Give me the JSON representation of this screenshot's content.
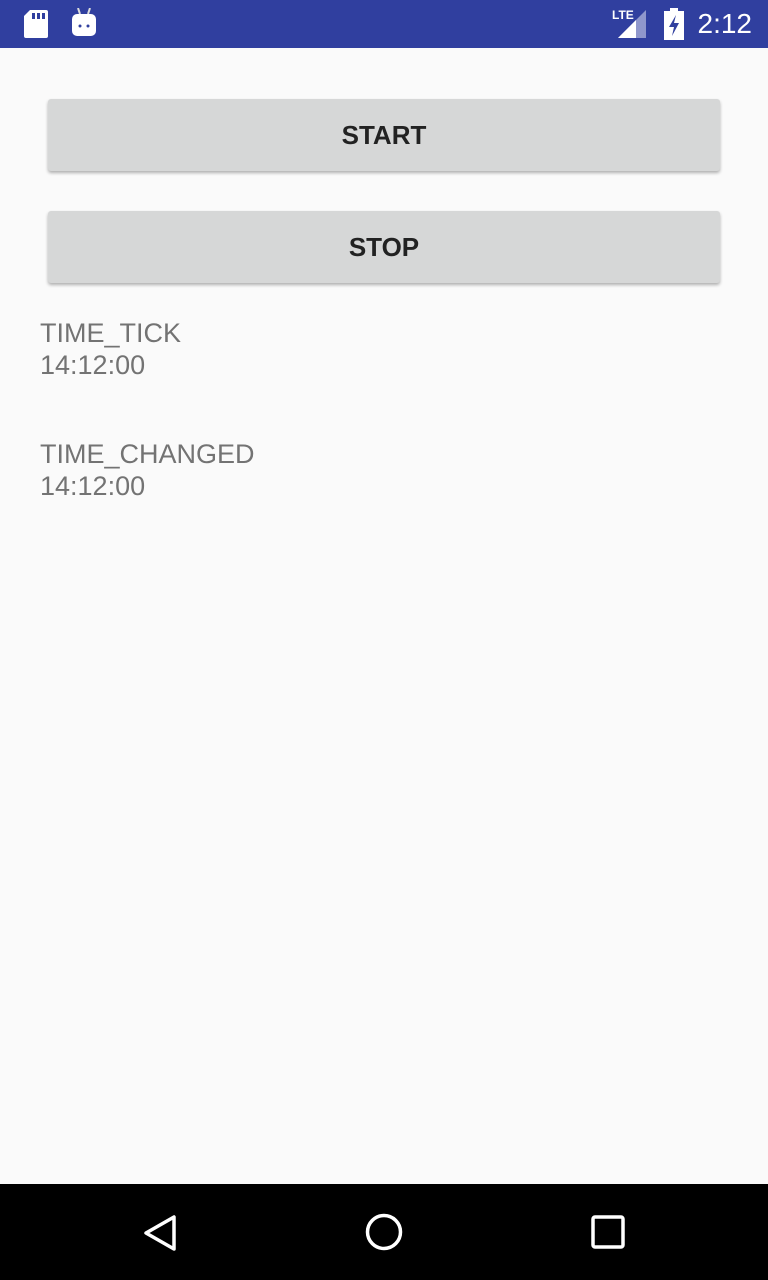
{
  "status_bar": {
    "time": "2:12",
    "network": "LTE",
    "icons": [
      "sd-card-icon",
      "android-icon",
      "lte-signal-icon",
      "battery-charging-icon"
    ]
  },
  "buttons": {
    "start": "START",
    "stop": "STOP"
  },
  "events": [
    {
      "label": "TIME_TICK",
      "time": "14:12:00"
    },
    {
      "label": "TIME_CHANGED",
      "time": "14:12:00"
    }
  ],
  "nav": {
    "icons": [
      "back-icon",
      "home-icon",
      "recents-icon"
    ]
  }
}
